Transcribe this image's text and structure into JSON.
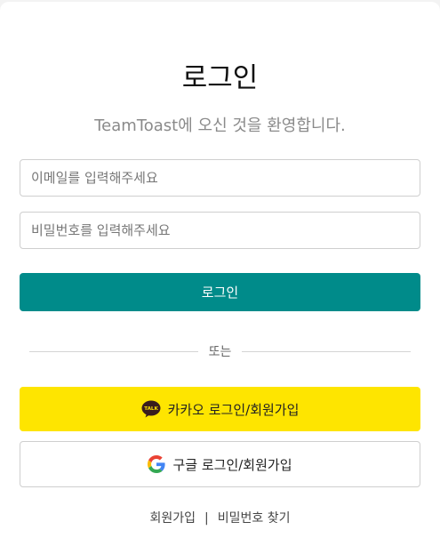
{
  "header": {
    "title": "로그인",
    "subtitle": "TeamToast에 오신 것을 환영합니다."
  },
  "form": {
    "email_placeholder": "이메일를 입력해주세요",
    "password_placeholder": "비밀번호를 입력해주세요",
    "login_label": "로그인"
  },
  "divider": {
    "label": "또는"
  },
  "social": {
    "kakao_label": "카카오 로그인/회원가입",
    "kakao_icon_text": "TALK",
    "google_label": "구글 로그인/회원가입"
  },
  "footer": {
    "signup_label": "회원가입",
    "separator": "|",
    "find_password_label": "비밀번호 찾기"
  },
  "colors": {
    "primary": "#008b8a",
    "kakao": "#fee500"
  }
}
